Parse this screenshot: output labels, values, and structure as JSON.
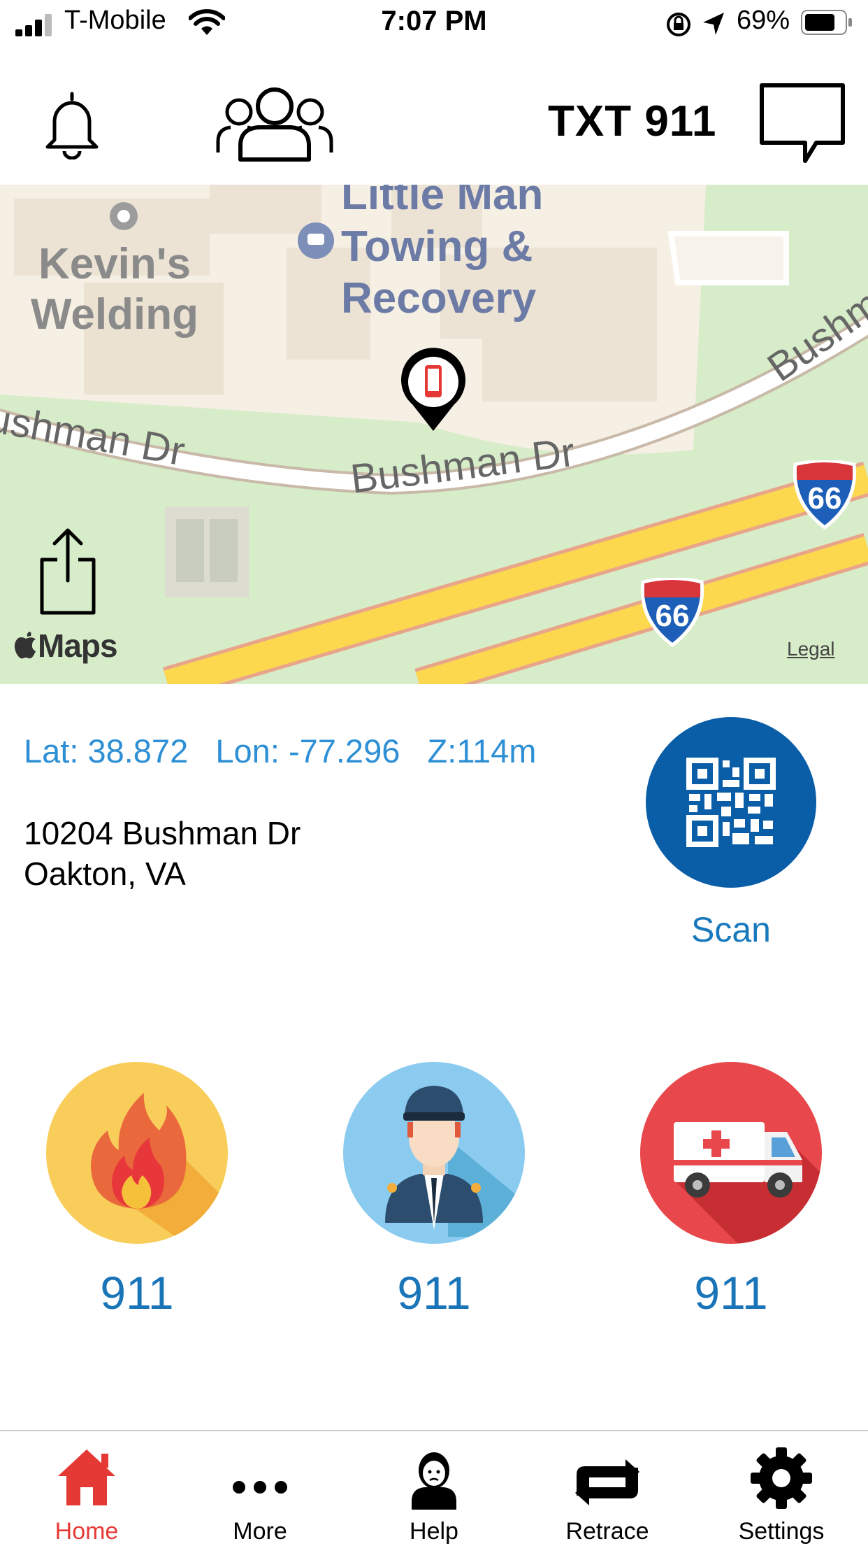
{
  "status_bar": {
    "carrier": "T-Mobile",
    "time": "7:07 PM",
    "battery": "69%"
  },
  "header": {
    "title": "TXT 911",
    "icons": [
      "bell-icon",
      "group-icon",
      "chat-bubble-icon"
    ]
  },
  "map": {
    "labels": {
      "business1_line1": "Kevin's",
      "business1_line2": "Welding",
      "business2_line1": "Little Man",
      "business2_line2": "Towing &",
      "business2_line3": "Recovery",
      "road_left": "ushman Dr",
      "road_center": "Bushman Dr",
      "road_right": "Bushma",
      "highway1": "66",
      "highway2": "66"
    },
    "logo": "Maps",
    "legal": "Legal"
  },
  "location": {
    "lat": "Lat: 38.872",
    "lon": "Lon: -77.296",
    "z": "Z:114m",
    "address_line1": "10204 Bushman Dr",
    "address_line2": "Oakton, VA"
  },
  "scan": {
    "label": "Scan"
  },
  "services": [
    {
      "label": "911",
      "icon": "fire-icon",
      "color": "#f9cd5a"
    },
    {
      "label": "911",
      "icon": "police-officer-icon",
      "color": "#8ccbf0"
    },
    {
      "label": "911",
      "icon": "ambulance-icon",
      "color": "#e8484b"
    }
  ],
  "tabs": [
    {
      "label": "Home",
      "icon": "home-icon",
      "active": true
    },
    {
      "label": "More",
      "icon": "more-dots-icon"
    },
    {
      "label": "Help",
      "icon": "help-person-icon"
    },
    {
      "label": "Retrace",
      "icon": "retrace-icon"
    },
    {
      "label": "Settings",
      "icon": "gear-icon"
    }
  ],
  "colors": {
    "accent_red": "#e53935",
    "link_blue": "#2d8fd5",
    "scan_blue": "#0a5ea8"
  }
}
